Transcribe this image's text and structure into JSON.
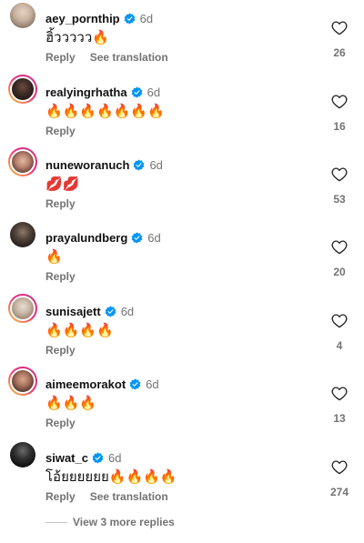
{
  "colors": {
    "text": "#111111",
    "muted": "#737373",
    "verified": "#0095f6",
    "story_ring_start": "#f9ce34",
    "story_ring_end": "#c13584"
  },
  "comments": [
    {
      "username": "aey_pornthip",
      "verified": true,
      "time": "6d",
      "text": "ฮิ้ววววว🔥",
      "reply_label": "Reply",
      "translation_label": "See translation",
      "likes": "26",
      "avatar_icon": "avatar-icon",
      "story_ring": false
    },
    {
      "username": "realyingrhatha",
      "verified": true,
      "time": "6d",
      "text": "🔥🔥🔥🔥🔥🔥🔥",
      "reply_label": "Reply",
      "likes": "16",
      "avatar_icon": "avatar-icon",
      "story_ring": true
    },
    {
      "username": "nuneworanuch",
      "verified": true,
      "time": "6d",
      "text": "💋💋",
      "reply_label": "Reply",
      "likes": "53",
      "avatar_icon": "avatar-icon",
      "story_ring": true
    },
    {
      "username": "prayalundberg",
      "verified": true,
      "time": "6d",
      "text": "🔥",
      "reply_label": "Reply",
      "likes": "20",
      "avatar_icon": "avatar-icon",
      "story_ring": false
    },
    {
      "username": "sunisajett",
      "verified": true,
      "time": "6d",
      "text": "🔥🔥🔥🔥",
      "reply_label": "Reply",
      "likes": "4",
      "avatar_icon": "avatar-icon",
      "story_ring": true
    },
    {
      "username": "aimeemorakot",
      "verified": true,
      "time": "6d",
      "text": "🔥🔥🔥",
      "reply_label": "Reply",
      "likes": "13",
      "avatar_icon": "avatar-icon",
      "story_ring": true
    },
    {
      "username": "siwat_c",
      "verified": true,
      "time": "6d",
      "text": "โอ้ยยยยยย🔥🔥🔥🔥",
      "reply_label": "Reply",
      "translation_label": "See translation",
      "likes": "274",
      "avatar_icon": "avatar-icon",
      "story_ring": false
    }
  ],
  "more_replies": {
    "label": "View 3 more replies"
  }
}
